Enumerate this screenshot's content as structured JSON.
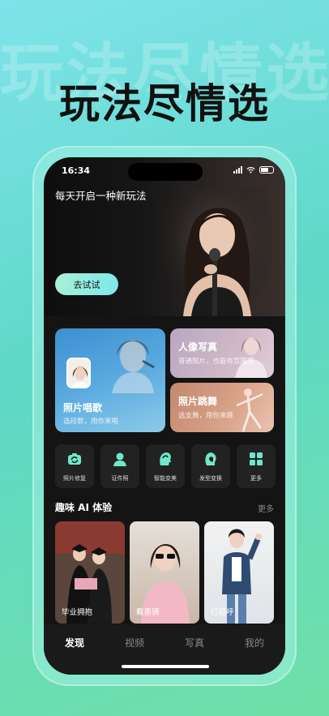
{
  "promo": {
    "watermark_text": "玩法尽情选",
    "headline": "玩法尽情选"
  },
  "status_bar": {
    "time": "16:34"
  },
  "hero": {
    "title": "每天开启一种新玩法",
    "button_label": "去试试"
  },
  "features": {
    "sing": {
      "title": "照片唱歌",
      "subtitle": "选段歌，用你来唱"
    },
    "portrait": {
      "title": "人像写真",
      "subtitle": "普通照片，也能有氛围感"
    },
    "dance": {
      "title": "照片跳舞",
      "subtitle": "选支舞，用你来跳"
    }
  },
  "tools": [
    {
      "label": "照片修复",
      "icon": "camera-refresh-icon"
    },
    {
      "label": "证件照",
      "icon": "person-id-icon"
    },
    {
      "label": "智能变美",
      "icon": "face-beauty-icon"
    },
    {
      "label": "发型变换",
      "icon": "hairstyle-icon"
    },
    {
      "label": "更多",
      "icon": "grid-more-icon"
    }
  ],
  "fun_ai": {
    "title": "趣味 AI 体验",
    "more": "更多",
    "items": [
      {
        "label": "毕业拥抱"
      },
      {
        "label": "戴墨镜"
      },
      {
        "label": "打招呼"
      }
    ]
  },
  "tabbar": {
    "tabs": [
      {
        "label": "发现",
        "active": true
      },
      {
        "label": "视频",
        "active": false
      },
      {
        "label": "写真",
        "active": false
      },
      {
        "label": "我的",
        "active": false
      }
    ]
  },
  "colors": {
    "accent_gradient_start": "#a8f0d8",
    "accent_gradient_end": "#7ee8ea",
    "screen_bg": "#141414",
    "promo_bg": "#6fe0c0"
  }
}
